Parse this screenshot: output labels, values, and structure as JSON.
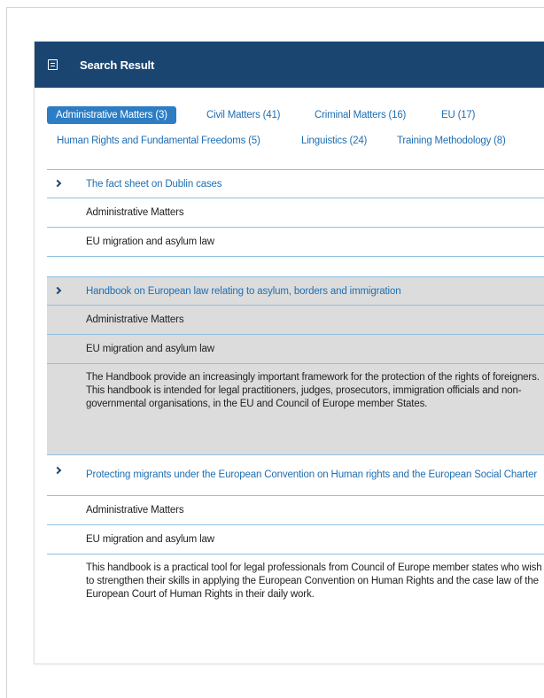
{
  "header": {
    "title": "Search Result",
    "icon": "document-list-icon"
  },
  "tabs": [
    {
      "label": "Administrative Matters (3)",
      "active": true
    },
    {
      "label": "Civil Matters (41)",
      "active": false
    },
    {
      "label": "Criminal Matters (16)",
      "active": false
    },
    {
      "label": "EU (17)",
      "active": false
    },
    {
      "label": "Human Rights and Fundamental Freedoms (5)",
      "active": false
    },
    {
      "label": "Linguistics (24)",
      "active": false
    },
    {
      "label": "Training Methodology (8)",
      "active": false
    }
  ],
  "results": [
    {
      "title": "The fact sheet on Dublin cases",
      "category": "Administrative Matters",
      "subcategory": "EU migration and asylum law",
      "description": ""
    },
    {
      "title": "Handbook on European law relating to asylum, borders and immigration",
      "category": "Administrative Matters",
      "subcategory": "EU migration and asylum law",
      "description": "The Handbook provide an increasingly important framework for the protection of the rights of foreigners. This handbook is intended for legal practitioners, judges, prosecutors, immigration officials and non-governmental organisations, in the EU and Council of Europe member States."
    },
    {
      "title": "Protecting migrants under the European Convention on Human rights and the European Social Charter",
      "category": "Administrative Matters",
      "subcategory": "EU migration and asylum law",
      "description": "This handbook is a practical tool for legal professionals from Council of Europe member states who wish to strengthen their skills in applying the European Convention on Human Rights and the case law of the European Court of Human Rights in their daily work."
    }
  ],
  "colors": {
    "header_bg": "#1b4571",
    "accent": "#2d7dc4",
    "link": "#1f6fb2",
    "divider": "#8fc1e3",
    "highlight_bg": "#dcdcdc"
  }
}
